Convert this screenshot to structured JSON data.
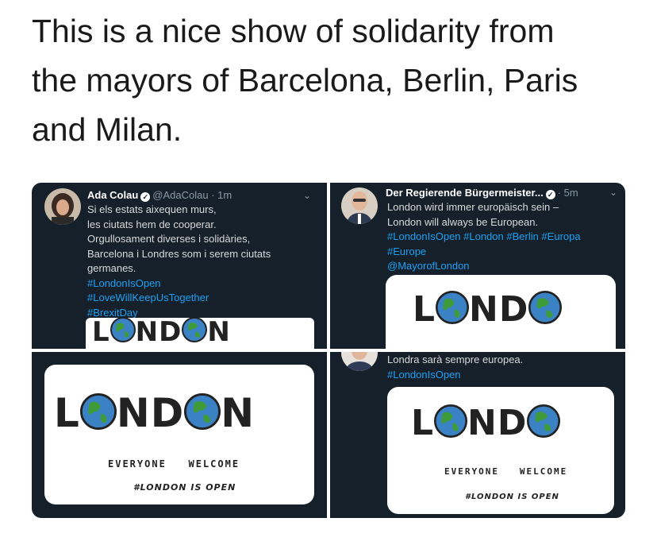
{
  "headline": {
    "line1": "This is a nice show of solidarity from",
    "line2": "the mayors of Barcelona, Berlin, Paris",
    "line3": "and Milan."
  },
  "tweet_colau": {
    "name": "Ada Colau",
    "handle": "@AdaColau",
    "time": "· 1m",
    "lines": [
      "Si els estats aixequen murs,",
      "les ciutats hem de cooperar.",
      "Orgullosament diverses i solidàries,",
      "Barcelona i Londres som i serem ciutats",
      "germanes."
    ],
    "hashtags": [
      "#LondonIsOpen",
      "#LoveWillKeepUsTogether",
      "#BrexitDay"
    ]
  },
  "tweet_berlin": {
    "name": "Der Regierende Bürgermeister...",
    "time": "· 5m",
    "lines": [
      "London wird immer europäisch sein –",
      "London will always be European."
    ],
    "hashtags_line1": "#LondonIsOpen #London #Berlin #Europa",
    "hashtags_line2": "#Europe",
    "mention": "@MayorofLondon"
  },
  "tweet_milan": {
    "line": "Londra sarà sempre europea.",
    "hashtag": "#LondonIsOpen"
  },
  "poster": {
    "letter_L": "L",
    "letters_ND": "ND",
    "letter_N": "N",
    "tagline_everyone": "EVERYONE",
    "tagline_welcome": "WELCOME",
    "hashtag": "#LONDON IS OPEN"
  },
  "colors": {
    "tweet_bg": "#15202b",
    "link": "#1da1f2",
    "ocean": "#3b82c4",
    "land": "#3f9b3a"
  }
}
